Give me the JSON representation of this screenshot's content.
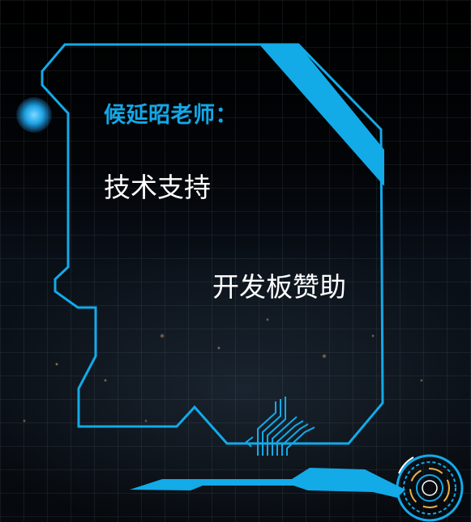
{
  "heading": "候延昭老师：",
  "items": [
    "技术支持",
    "开发板赞助"
  ],
  "colors": {
    "accent": "#12a8e8",
    "text": "#ffffff",
    "background": "#000000"
  },
  "icons": [
    "glow-dot-icon",
    "circuit-lines-icon",
    "hud-circle-icon"
  ]
}
